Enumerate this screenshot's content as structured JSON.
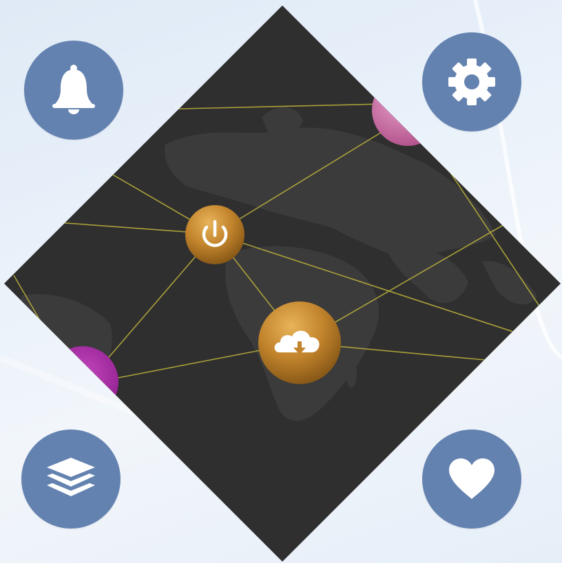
{
  "app": {
    "name": "",
    "colors": {
      "background": "#e6eef8",
      "diamond": "#2f2f2f",
      "continents": "#3d3d3d",
      "link_lines": "#b8ad3c",
      "node_gold": "#c88a2e",
      "node_pink": "#c86a9e",
      "node_purple": "#a2249e",
      "corner_button": "#6482b0",
      "icon": "#ffffff"
    }
  },
  "corner_buttons": [
    {
      "id": "notifications",
      "icon": "bell-icon"
    },
    {
      "id": "settings",
      "icon": "gear-icon"
    },
    {
      "id": "layers",
      "icon": "layers-icon"
    },
    {
      "id": "favorites",
      "icon": "heart-icon"
    }
  ],
  "map": {
    "nodes": [
      {
        "id": "power",
        "icon": "power-icon",
        "color": "gold"
      },
      {
        "id": "cloud-download",
        "icon": "cloud-download-icon",
        "color": "gold"
      },
      {
        "id": "node-east",
        "color": "pink"
      },
      {
        "id": "node-west",
        "color": "purple"
      }
    ]
  }
}
